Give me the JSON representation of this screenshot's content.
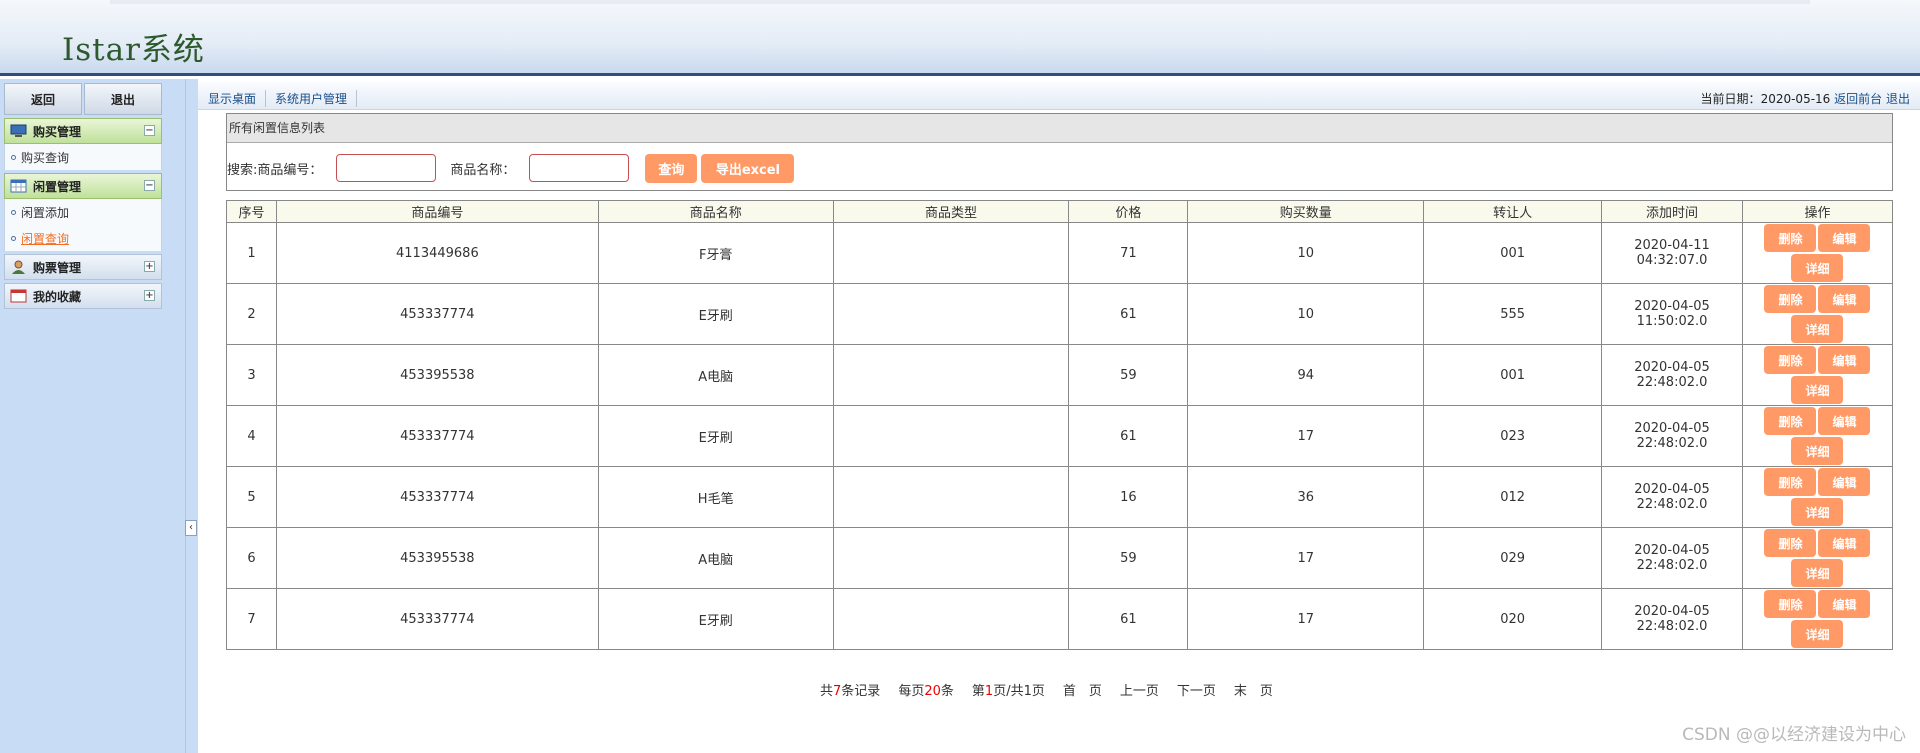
{
  "app": {
    "title": "Istar系统"
  },
  "sidebar": {
    "back_label": "返回",
    "logout_label": "退出",
    "groups": [
      {
        "label": "购买管理",
        "toggle": "−",
        "items": [
          {
            "label": "购买查询"
          }
        ]
      },
      {
        "label": "闲置管理",
        "toggle": "−",
        "items": [
          {
            "label": "闲置添加"
          },
          {
            "label": "闲置查询"
          }
        ]
      },
      {
        "label": "购票管理",
        "toggle": "+"
      },
      {
        "label": "我的收藏",
        "toggle": "+"
      }
    ],
    "collapse_glyph": "‹"
  },
  "navbar": {
    "links": [
      "显示桌面",
      "系统用户管理"
    ],
    "date_label": "当前日期：",
    "date_value": "2020-05-16",
    "back_front": "返回前台",
    "logout": "退出"
  },
  "search": {
    "panel_title": "所有闲置信息列表",
    "prefix": "搜索:",
    "code_label": "商品编号：",
    "name_label": "商品名称：",
    "code_value": "",
    "name_value": "",
    "query_button": "查询",
    "export_button": "导出excel"
  },
  "table": {
    "headers": [
      "序号",
      "商品编号",
      "商品名称",
      "商品类型",
      "价格",
      "购买数量",
      "转让人",
      "添加时间",
      "操作"
    ],
    "rows": [
      {
        "no": "1",
        "code": "4113449686",
        "name": "F牙膏",
        "type": "",
        "price": "71",
        "qty": "10",
        "seller": "001",
        "date": "2020-04-11",
        "time": "04:32:07.0"
      },
      {
        "no": "2",
        "code": "453337774",
        "name": "E牙刷",
        "type": "",
        "price": "61",
        "qty": "10",
        "seller": "555",
        "date": "2020-04-05",
        "time": "11:50:02.0"
      },
      {
        "no": "3",
        "code": "453395538",
        "name": "A电脑",
        "type": "",
        "price": "59",
        "qty": "94",
        "seller": "001",
        "date": "2020-04-05",
        "time": "22:48:02.0"
      },
      {
        "no": "4",
        "code": "453337774",
        "name": "E牙刷",
        "type": "",
        "price": "61",
        "qty": "17",
        "seller": "023",
        "date": "2020-04-05",
        "time": "22:48:02.0"
      },
      {
        "no": "5",
        "code": "453337774",
        "name": "H毛笔",
        "type": "",
        "price": "16",
        "qty": "36",
        "seller": "012",
        "date": "2020-04-05",
        "time": "22:48:02.0"
      },
      {
        "no": "6",
        "code": "453395538",
        "name": "A电脑",
        "type": "",
        "price": "59",
        "qty": "17",
        "seller": "029",
        "date": "2020-04-05",
        "time": "22:48:02.0"
      },
      {
        "no": "7",
        "code": "453337774",
        "name": "E牙刷",
        "type": "",
        "price": "61",
        "qty": "17",
        "seller": "020",
        "date": "2020-04-05",
        "time": "22:48:02.0"
      }
    ],
    "actions": {
      "delete": "删除",
      "edit": "编辑",
      "detail": "详细"
    }
  },
  "pager": {
    "total_prefix": "共",
    "total": "7",
    "total_suffix": "条记录",
    "per_prefix": "每页",
    "per": "20",
    "per_suffix": "条",
    "page_prefix": "第",
    "page": "1",
    "page_suffix": "页/共1页",
    "first": "首　页",
    "prev": "上一页",
    "next": "下一页",
    "last": "末　页"
  },
  "watermark": "CSDN @@以经济建设为中心",
  "colors": {
    "accent_orange": "#ff9a66",
    "header_bar": "#2f4f7a",
    "sidebar_bg": "#c8dcf5",
    "menu_green": "#bfe19a"
  }
}
